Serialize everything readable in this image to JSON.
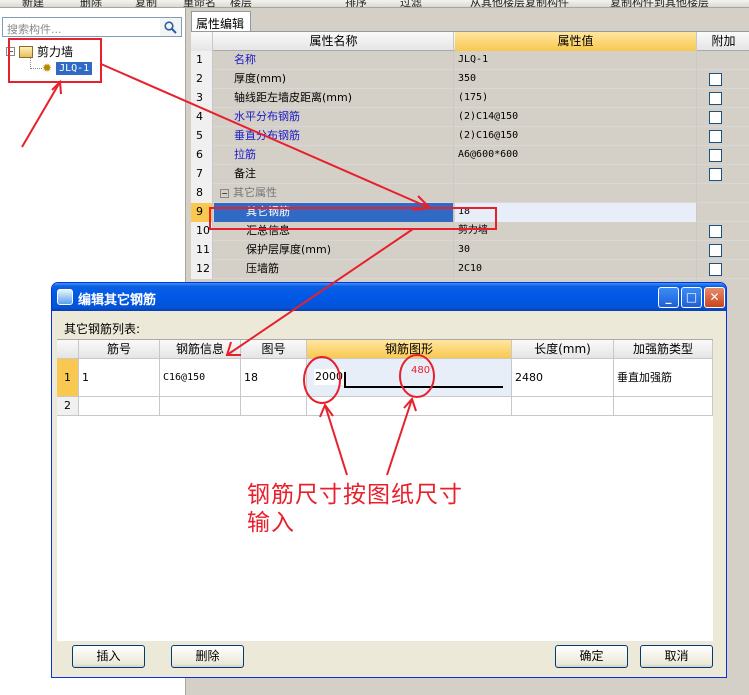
{
  "toolbar": {
    "items": [
      "新建",
      "删除",
      "复制",
      "重命名",
      "楼层",
      "",
      "排序",
      "过滤",
      "从其他楼层复制构件",
      "复制构件到其他楼层"
    ]
  },
  "search": {
    "placeholder": "搜索构件..."
  },
  "tree": {
    "root_label": "剪力墙",
    "child_label": "JLQ-1"
  },
  "property_editor": {
    "tab_label": "属性编辑",
    "headers": {
      "name": "属性名称",
      "value": "属性值",
      "add": "附加"
    },
    "rows": [
      {
        "num": "1",
        "name": "名称",
        "value": "JLQ-1"
      },
      {
        "num": "2",
        "name": "厚度(mm)",
        "value": "350"
      },
      {
        "num": "3",
        "name": "轴线距左墙皮距离(mm)",
        "value": "(175)"
      },
      {
        "num": "4",
        "name": "水平分布钢筋",
        "value": "(2)C14@150"
      },
      {
        "num": "5",
        "name": "垂直分布钢筋",
        "value": "(2)C16@150"
      },
      {
        "num": "6",
        "name": "拉筋",
        "value": "A6@600*600"
      },
      {
        "num": "7",
        "name": "备注",
        "value": ""
      },
      {
        "num": "8",
        "name": "其它属性",
        "value": ""
      },
      {
        "num": "9",
        "name": "其它钢筋",
        "value": "18"
      },
      {
        "num": "10",
        "name": "汇总信息",
        "value": "剪力墙"
      },
      {
        "num": "11",
        "name": "保护层厚度(mm)",
        "value": "30"
      },
      {
        "num": "12",
        "name": "压墙筋",
        "value": "2C10"
      }
    ]
  },
  "dialog": {
    "title": "编辑其它钢筋",
    "list_label": "其它钢筋列表:",
    "headers": [
      "",
      "筋号",
      "钢筋信息",
      "图号",
      "钢筋图形",
      "长度(mm)",
      "加强筋类型"
    ],
    "rows": [
      {
        "num": "1",
        "bar_no": "1",
        "bar_info": "C16@150",
        "fig_no": "18",
        "shape_left": "2000",
        "shape_top": "480",
        "length": "2480",
        "type": "垂直加强筋"
      },
      {
        "num": "2",
        "bar_no": "",
        "bar_info": "",
        "fig_no": "",
        "shape_left": "",
        "shape_top": "",
        "length": "",
        "type": ""
      }
    ],
    "buttons": {
      "insert": "插入",
      "delete": "删除",
      "ok": "确定",
      "cancel": "取消"
    },
    "window_buttons": {
      "min": "_",
      "max": "□",
      "close": "✕"
    }
  },
  "annotation": {
    "line1": "钢筋尺寸按图纸尺寸",
    "line2": "输入",
    "color": "#e8202c"
  },
  "colors": {
    "selection": "#316ac5",
    "header_highlight": "#f8c850",
    "link_blue": "#1a1ac8",
    "title_bar": "#0058e6"
  }
}
